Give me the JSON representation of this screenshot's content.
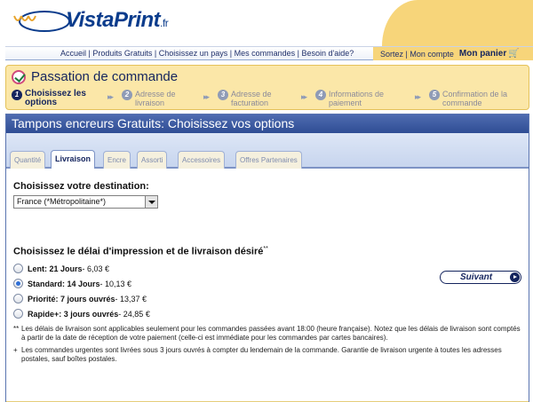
{
  "brand": {
    "name_main": "VistaPrint",
    "name_suffix": ".fr"
  },
  "topnav": {
    "links": "Accueil | Produits Gratuits | Choisissez un pays | Mes commandes | Besoin d'aide?",
    "account_links": "Sortez | Mon compte",
    "cart": "Mon panier"
  },
  "order_process": {
    "title": "Passation de commande",
    "steps": [
      {
        "num": "1",
        "label": "Choisissez les options",
        "active": true
      },
      {
        "num": "2",
        "label": "Adresse de livraison",
        "active": false
      },
      {
        "num": "3",
        "label": "Adresse de facturation",
        "active": false
      },
      {
        "num": "4",
        "label": "Informations de paiement",
        "active": false
      },
      {
        "num": "5",
        "label": "Confirmation de la commande",
        "active": false
      }
    ]
  },
  "panel": {
    "title": "Tampons encreurs Gratuits: Choisissez vos options",
    "tabs": [
      "Quantité",
      "Livraison",
      "Encre",
      "Assorti",
      "Accessoires",
      "Offres Partenaires"
    ],
    "active_tab": "Livraison"
  },
  "destination": {
    "heading": "Choisissez votre destination:",
    "selected": "France (*Métropolitaine*)"
  },
  "delivery": {
    "heading": "Choisissez le délai d'impression et de livraison désiré",
    "heading_mark": "**",
    "options": [
      {
        "label": "Lent: 21 Jours",
        "price": " - 6,03 €",
        "checked": false
      },
      {
        "label": "Standard: 14 Jours",
        "price": " - 10,13 €",
        "checked": true
      },
      {
        "label": "Priorité: 7 jours ouvrés",
        "price": " - 13,37 €",
        "checked": false
      },
      {
        "label": "Rapide+: 3 jours ouvrés",
        "price": " - 24,85 €",
        "checked": false
      }
    ]
  },
  "notes": [
    {
      "mark": "**",
      "text": "Les délais de livraison sont applicables seulement pour les commandes passées avant 18:00 (heure française). Notez que les délais de livraison sont comptés à partir de la date de réception de votre paiement (celle-ci est immédiate pour les commandes par cartes bancaires)."
    },
    {
      "mark": "+",
      "text": "Les commandes urgentes sont livrées sous 3 jours ouvrés à compter du lendemain de la commande. Garantie de livraison urgente à toutes les adresses postales, sauf boîtes postales."
    }
  ],
  "next_button": "Suivant",
  "colors": {
    "brand_blue": "#14245e",
    "accent_yellow": "#f7d57a",
    "panel_header": "#2f4d94"
  }
}
